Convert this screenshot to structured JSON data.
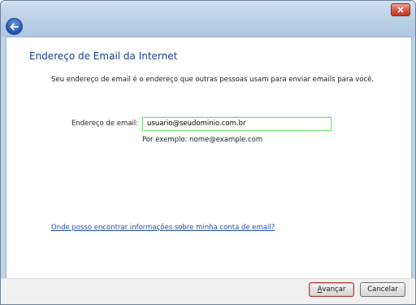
{
  "icons": {
    "close": "close-icon",
    "back": "back-arrow-icon"
  },
  "colors": {
    "heading": "#1c3f94",
    "link": "#1f4fb3",
    "focus_border": "#7ddf76",
    "close_button": "#d5553e"
  },
  "page": {
    "heading": "Endereço de Email da Internet",
    "description": "Seu endereço de email é o endereço que outras pessoas usam para enviar emails para você."
  },
  "form": {
    "email_label": "Endereço de email:",
    "email_value": "usuario@seudominio.com.br",
    "example": "Por exemplo: nome@example.com"
  },
  "help_link": "Onde posso encontrar informações sobre minha conta de email?",
  "footer": {
    "next_label_key": "A",
    "next_label_rest": "vançar",
    "cancel_label": "Cancelar"
  }
}
